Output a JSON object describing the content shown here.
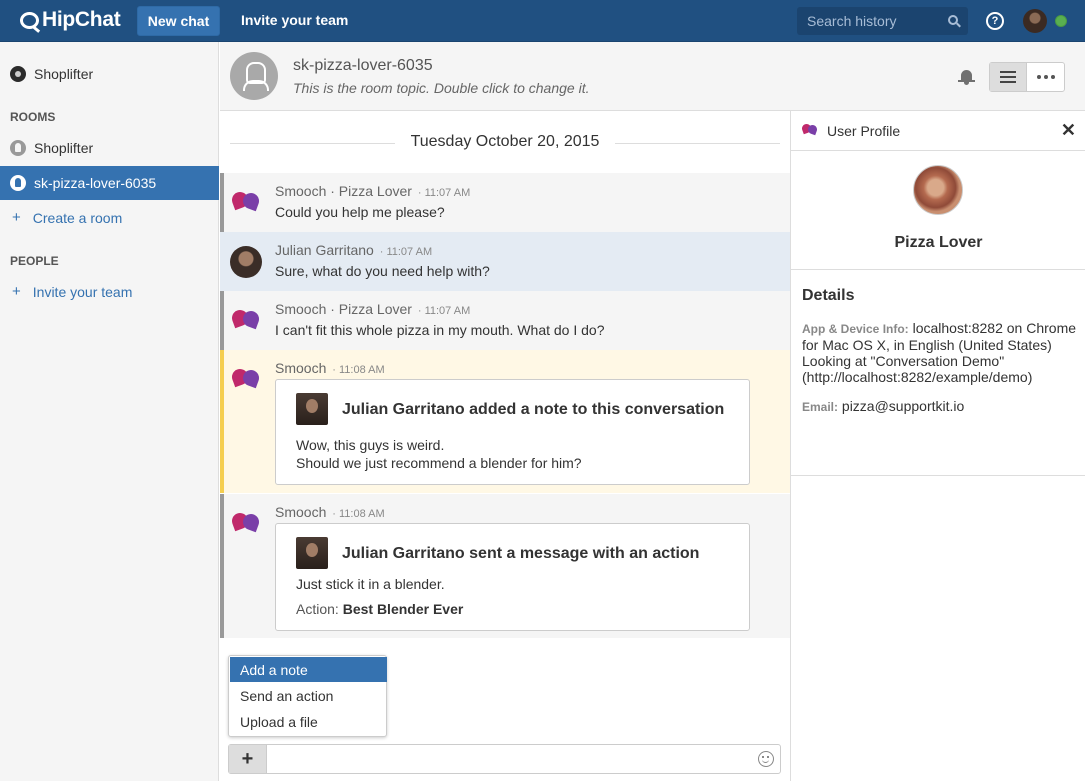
{
  "app": {
    "logo": "HipChat",
    "new_chat": "New chat",
    "invite_team": "Invite your team",
    "search_placeholder": "Search history",
    "help": "?",
    "status_color": "#59af50",
    "brand_color": "#205081"
  },
  "sidebar": {
    "top_item": "Shoplifter",
    "rooms_heading": "ROOMS",
    "rooms": [
      {
        "label": "Shoplifter"
      },
      {
        "label": "sk-pizza-lover-6035"
      }
    ],
    "create_room": "Create a room",
    "people_heading": "PEOPLE",
    "invite_team": "Invite your team",
    "plus": "+"
  },
  "room": {
    "name": "sk-pizza-lover-6035",
    "topic": "This is the room topic. Double click to change it."
  },
  "chat": {
    "date": "Tuesday October 20, 2015",
    "messages": [
      {
        "sender": "Smooch · Pizza Lover",
        "time": "11:07 AM",
        "text": "Could you help me please?"
      },
      {
        "sender": "Julian Garritano",
        "time": "11:07 AM",
        "text": "Sure, what do you need help with?"
      },
      {
        "sender": "Smooch · Pizza Lover",
        "time": "11:07 AM",
        "text": "I can't fit this whole pizza in my mouth. What do I do?"
      },
      {
        "sender": "Smooch",
        "time": "11:08 AM",
        "card_title": "Julian Garritano added a note to this conversation",
        "card_line1": "Wow, this guys is weird.",
        "card_line2": "Should we just recommend a blender for him?"
      },
      {
        "sender": "Smooch",
        "time": "11:08 AM",
        "card_title": "Julian Garritano sent a message with an action",
        "card_line1": "Just stick it in a blender.",
        "action_label": "Action:",
        "action_value": "Best Blender Ever"
      }
    ]
  },
  "popup_menu": {
    "items": [
      {
        "label": "Add a note"
      },
      {
        "label": "Send an action"
      },
      {
        "label": "Upload a file"
      }
    ]
  },
  "composer": {
    "plus": "+",
    "placeholder": ""
  },
  "profile_panel": {
    "title": "User Profile",
    "close": "✕",
    "name": "Pizza Lover",
    "details_heading": "Details",
    "info_label": "App & Device Info:",
    "info_value": "localhost:8282 on Chrome for Mac OS X, in English (United States) Looking at \"Conversation Demo\" (http://localhost:8282/example/demo)",
    "email_label": "Email:",
    "email_value": "pizza@supportkit.io"
  }
}
